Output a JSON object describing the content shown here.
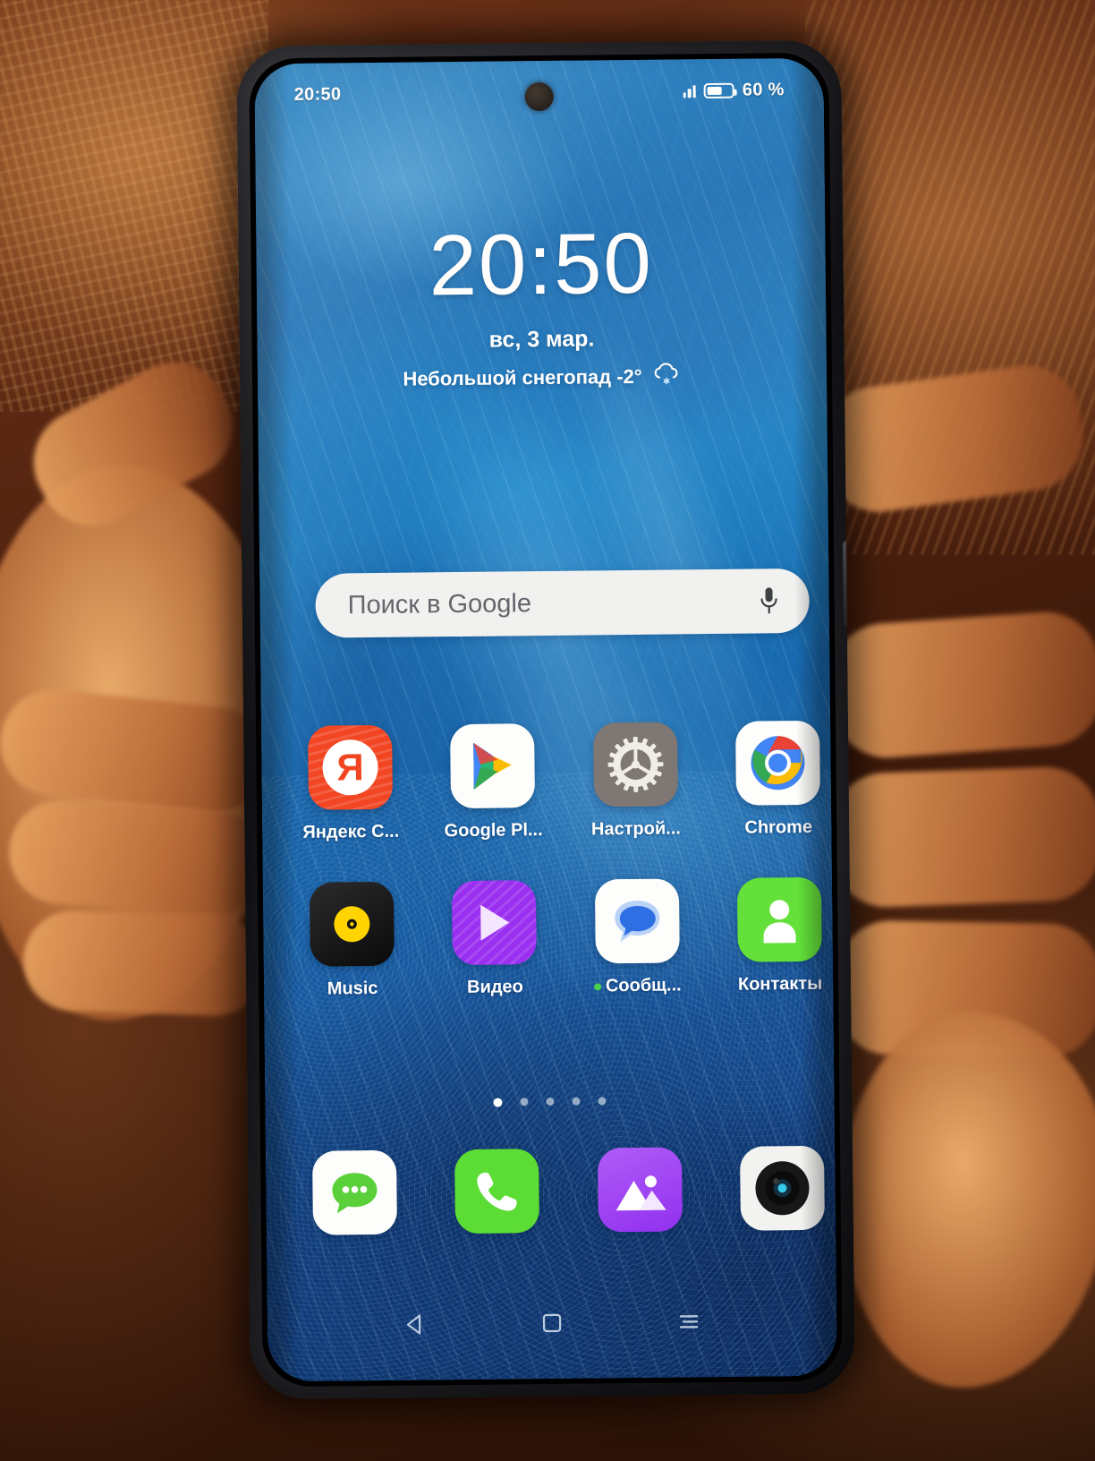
{
  "status_bar": {
    "time": "20:50",
    "battery_percent": "60 %",
    "signal_icon": "signal-bars-icon",
    "battery_icon": "battery-icon",
    "battery_level": 60
  },
  "clock_widget": {
    "time": "20:50",
    "date": "вс, 3 мар.",
    "weather": "Небольшой снегопад -2°",
    "weather_icon": "snow-cloud-icon"
  },
  "search": {
    "placeholder": "Поиск в Google",
    "mic_icon": "microphone-icon"
  },
  "app_grid": {
    "rows": [
      {
        "apps": [
          {
            "label": "Яндекс С...",
            "icon": "yandex-icon",
            "glyph": "Я",
            "badge": false
          },
          {
            "label": "Google Pl...",
            "icon": "google-play-icon",
            "badge": false
          },
          {
            "label": "Настрой...",
            "icon": "settings-gear-icon",
            "badge": false
          },
          {
            "label": "Chrome",
            "icon": "chrome-icon",
            "badge": false
          }
        ]
      },
      {
        "apps": [
          {
            "label": "Music",
            "icon": "music-disc-icon",
            "badge": false
          },
          {
            "label": "Видео",
            "icon": "video-play-icon",
            "badge": false
          },
          {
            "label": "Сообщ...",
            "icon": "messages-bubble-icon",
            "badge": true
          },
          {
            "label": "Контакты",
            "icon": "contacts-person-icon",
            "badge": false
          }
        ]
      }
    ]
  },
  "page_indicator": {
    "total": 5,
    "active": 1
  },
  "dock": {
    "apps": [
      {
        "name": "sms-messaging",
        "icon": "sms-bubble-icon"
      },
      {
        "name": "phone-dialer",
        "icon": "phone-handset-icon"
      },
      {
        "name": "gallery",
        "icon": "gallery-mountain-icon"
      },
      {
        "name": "camera",
        "icon": "camera-lens-icon"
      }
    ]
  },
  "nav_bar": {
    "back": "back-triangle-icon",
    "home": "home-square-icon",
    "recents": "recents-lines-icon"
  },
  "colors": {
    "wallpaper_blue": "#1a6fb6",
    "yandex_red": "#f24522",
    "settings_grey": "#7e7774",
    "video_purple": "#9b2ff0",
    "contacts_green": "#63e03a",
    "phone_green": "#5cdd35",
    "gallery_purple": "#9130ef",
    "badge_green": "#48d14a"
  }
}
